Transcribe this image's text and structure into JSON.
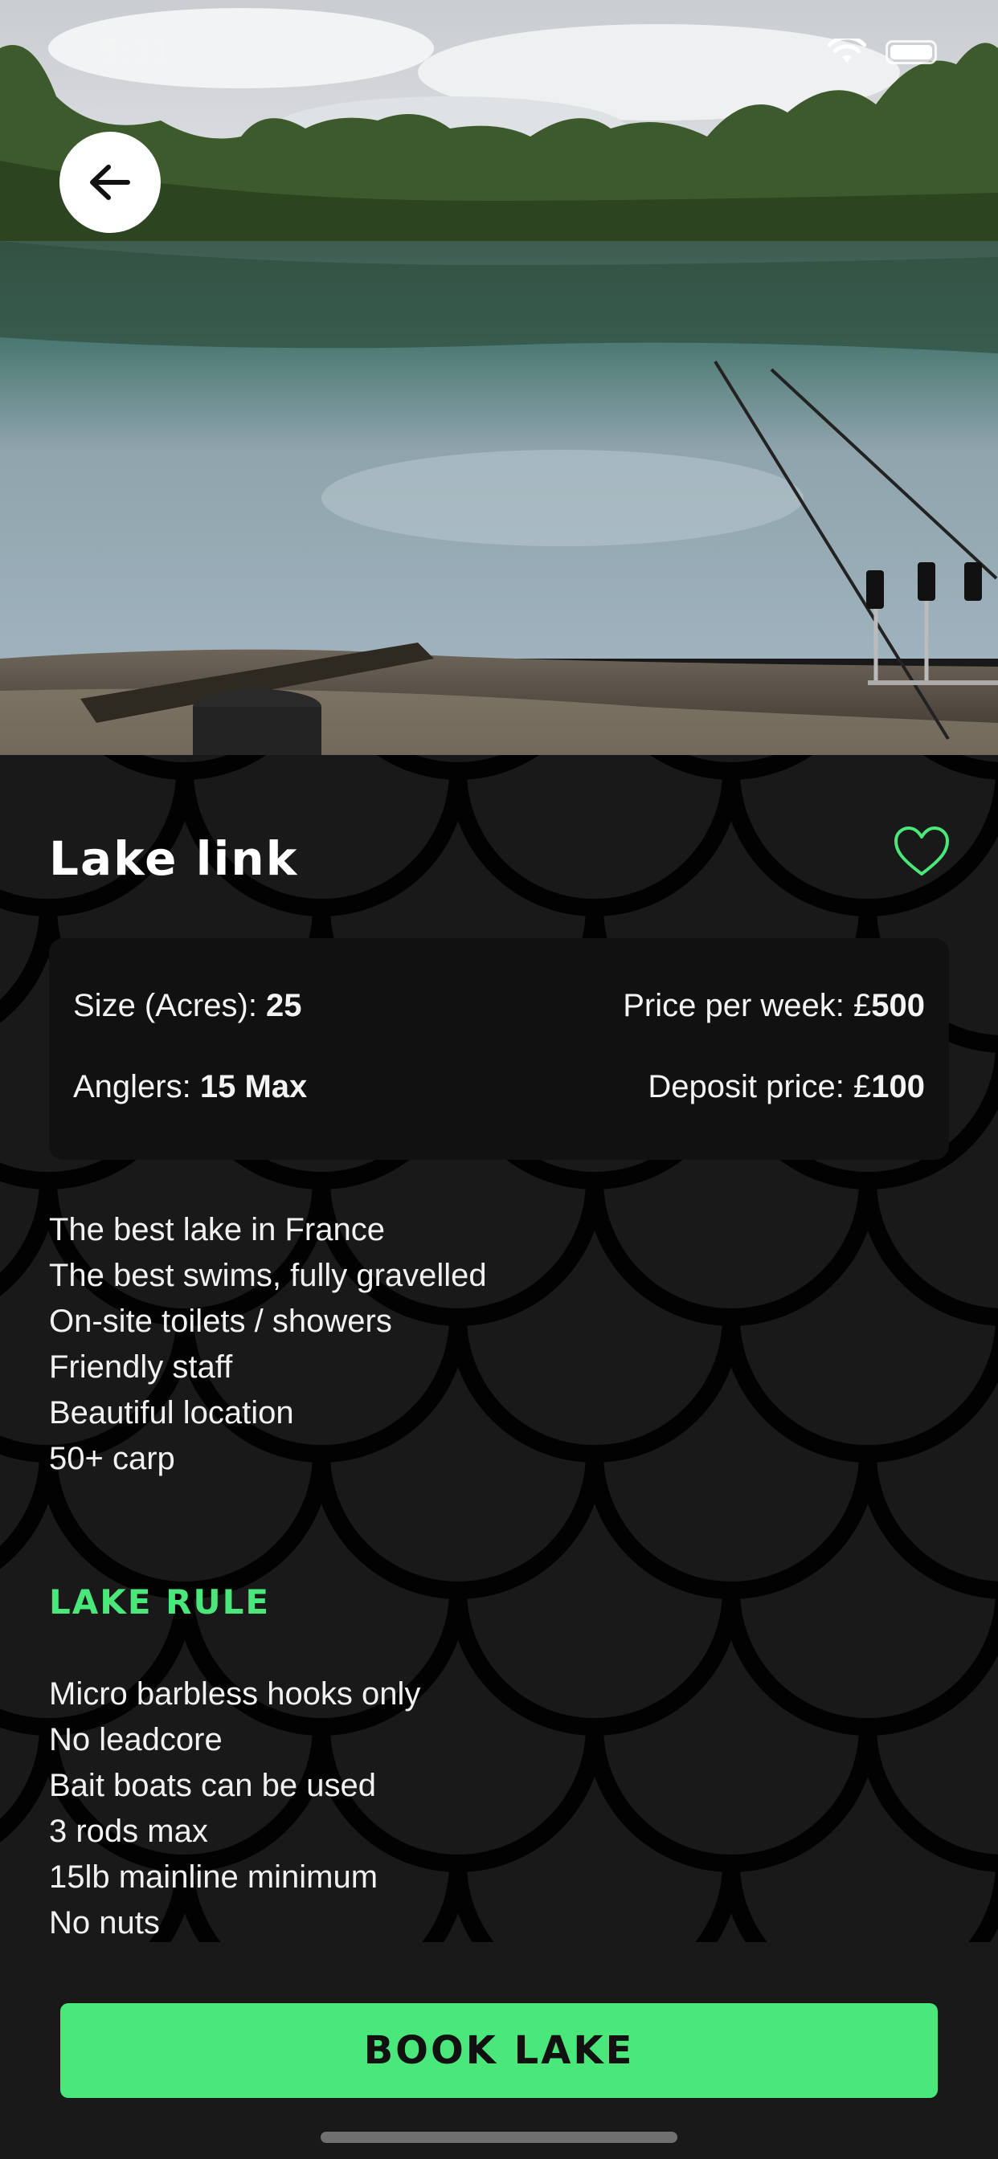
{
  "status_bar": {
    "time": "5:31"
  },
  "hero": {
    "image": "lake-with-fishing-rods-photo"
  },
  "lake": {
    "name": "Lake link",
    "favorite_icon": "heart-outline-icon",
    "size_label": "Size (Acres): ",
    "size_value": "25",
    "price_label": "Price per week: £",
    "price_value": "500",
    "anglers_label": "Anglers: ",
    "anglers_value": "15 Max",
    "deposit_label": "Deposit price: £",
    "deposit_value": "100"
  },
  "features": [
    "The best lake in France",
    "The best swims,  fully gravelled",
    "On-site toilets / showers",
    "Friendly staff",
    "Beautiful location",
    "50+ carp"
  ],
  "rules_heading": "LAKE RULE",
  "rules": [
    "Micro barbless hooks only",
    "No leadcore",
    "Bait boats can be used",
    "3 rods max",
    "15lb mainline minimum",
    "No nuts"
  ],
  "actions": {
    "book_label": "BOOK LAKE"
  },
  "colors": {
    "accent": "#4ae87a",
    "background": "#191919",
    "card": "#111111"
  }
}
